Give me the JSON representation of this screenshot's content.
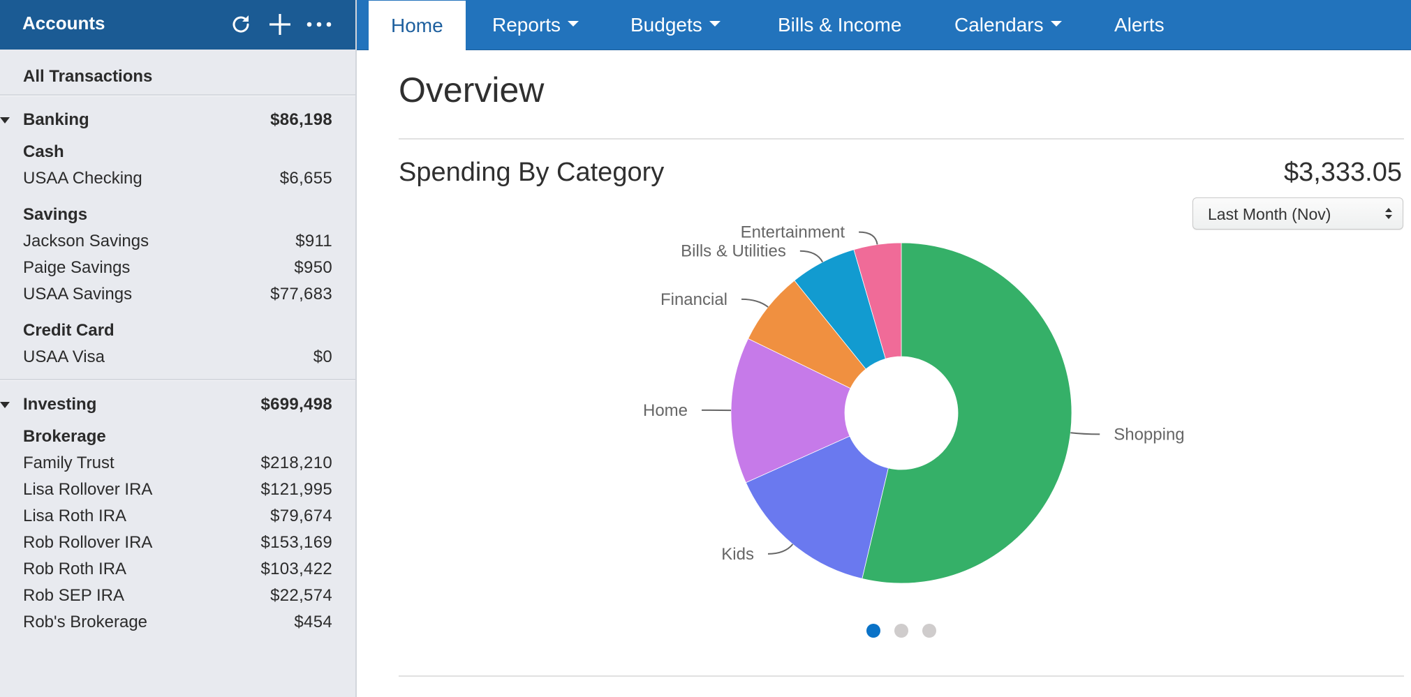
{
  "sidebar": {
    "title": "Accounts",
    "icons": [
      "refresh-icon",
      "plus-icon",
      "more-icon"
    ],
    "all_transactions": "All Transactions",
    "groups": [
      {
        "name": "Banking",
        "total": "$86,198",
        "sections": [
          {
            "name": "Cash",
            "accounts": [
              {
                "name": "USAA Checking",
                "balance": "$6,655"
              }
            ]
          },
          {
            "name": "Savings",
            "accounts": [
              {
                "name": "Jackson Savings",
                "balance": "$911"
              },
              {
                "name": "Paige Savings",
                "balance": "$950"
              },
              {
                "name": "USAA Savings",
                "balance": "$77,683"
              }
            ]
          },
          {
            "name": "Credit Card",
            "accounts": [
              {
                "name": "USAA Visa",
                "balance": "$0"
              }
            ]
          }
        ]
      },
      {
        "name": "Investing",
        "total": "$699,498",
        "sections": [
          {
            "name": "Brokerage",
            "accounts": [
              {
                "name": "Family Trust",
                "balance": "$218,210"
              },
              {
                "name": "Lisa Rollover IRA",
                "balance": "$121,995"
              },
              {
                "name": "Lisa Roth IRA",
                "balance": "$79,674"
              },
              {
                "name": "Rob Rollover IRA",
                "balance": "$153,169"
              },
              {
                "name": "Rob Roth IRA",
                "balance": "$103,422"
              },
              {
                "name": "Rob SEP IRA",
                "balance": "$22,574"
              },
              {
                "name": "Rob's Brokerage",
                "balance": "$454"
              }
            ]
          }
        ]
      }
    ]
  },
  "nav": {
    "tabs": [
      {
        "label": "Home",
        "active": true,
        "dropdown": false
      },
      {
        "label": "Reports",
        "active": false,
        "dropdown": true
      },
      {
        "label": "Budgets",
        "active": false,
        "dropdown": true
      },
      {
        "label": "Bills & Income",
        "active": false,
        "dropdown": false
      },
      {
        "label": "Calendars",
        "active": false,
        "dropdown": true
      },
      {
        "label": "Alerts",
        "active": false,
        "dropdown": false
      }
    ]
  },
  "main": {
    "title": "Overview",
    "section_title": "Spending By Category",
    "total": "$3,333.05",
    "period_select": {
      "value": "Last Month (Nov)"
    },
    "carousel": {
      "count": 3,
      "active_index": 0
    }
  },
  "colors": {
    "sidebar_header": "#1b5b94",
    "nav_bar": "#2273bc",
    "active_tab_text": "#1d5f9e",
    "carousel_active": "#0a72c7",
    "carousel_inactive": "#cfcccc"
  },
  "chart_data": {
    "type": "pie",
    "style": "donut",
    "title": "Spending By Category",
    "total": 3333.05,
    "start": "top, clockwise",
    "slices": [
      {
        "label": "Shopping",
        "percent": 53.7,
        "approx_value": 1789,
        "color": "#35b068"
      },
      {
        "label": "Kids",
        "percent": 14.6,
        "approx_value": 487,
        "color": "#6a79ef"
      },
      {
        "label": "Home",
        "percent": 13.9,
        "approx_value": 465,
        "color": "#c67ae9"
      },
      {
        "label": "Financial",
        "percent": 7.0,
        "approx_value": 233,
        "color": "#f09040"
      },
      {
        "label": "Bills & Utilities",
        "percent": 6.3,
        "approx_value": 211,
        "color": "#129bd0"
      },
      {
        "label": "Entertainment",
        "percent": 4.5,
        "approx_value": 149,
        "color": "#f06b98"
      }
    ],
    "legend": "none (leader-line labels)"
  }
}
